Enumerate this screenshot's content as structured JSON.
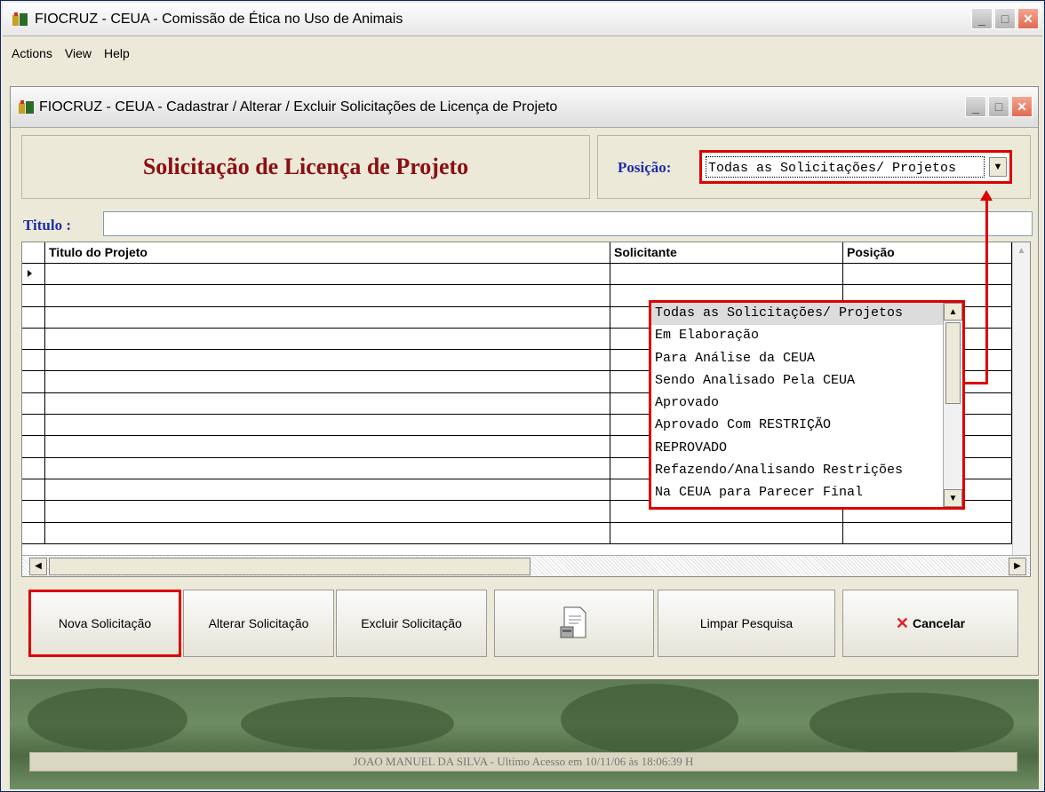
{
  "window": {
    "title": "FIOCRUZ - CEUA - Comissão de Ética no Uso de Animais",
    "menu": [
      "Actions",
      "View",
      "Help"
    ]
  },
  "dialog": {
    "title": "FIOCRUZ - CEUA - Cadastrar / Alterar / Excluir Solicitações de Licença de Projeto",
    "heading": "Solicitação de Licença de Projeto",
    "posicao_label": "Posição:",
    "posicao_value": "Todas as Solicitações/ Projetos",
    "titulo_label": "Titulo :",
    "titulo_value": ""
  },
  "grid": {
    "columns": [
      "Titulo do Projeto",
      "Solicitante",
      "Posição"
    ]
  },
  "dropdown": {
    "options": [
      "Todas as Solicitações/ Projetos",
      "Em Elaboração",
      "Para Análise da CEUA",
      "Sendo Analisado Pela CEUA",
      "Aprovado",
      "Aprovado Com RESTRIÇÃO",
      "REPROVADO",
      "Refazendo/Analisando Restrições",
      "Na CEUA para Parecer Final"
    ]
  },
  "buttons": {
    "nova": "Nova Solicitação",
    "alterar": "Alterar Solicitação",
    "excluir": "Excluir Solicitação",
    "limpar": "Limpar Pesquisa",
    "cancelar": "Cancelar"
  },
  "status": {
    "text": "JOAO MANUEL DA SILVA - Ultimo Acesso em 10/11/06 às 18:06:39 H"
  },
  "colors": {
    "heading": "#8b0f14",
    "label_blue": "#1e2ea8",
    "highlight_red": "#dd0000"
  }
}
